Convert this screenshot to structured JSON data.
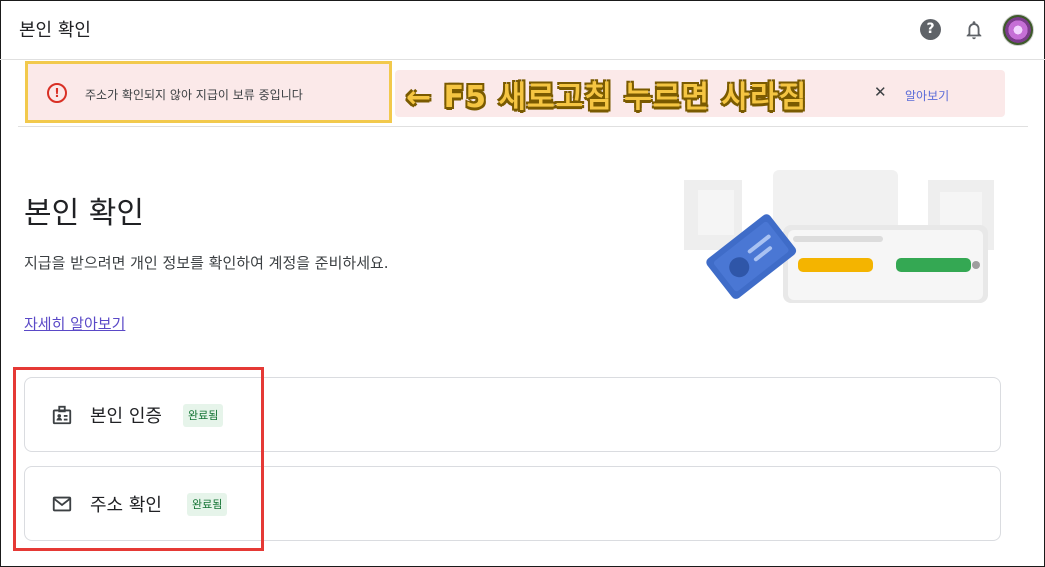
{
  "header": {
    "title": "본인 확인",
    "help_icon": "help-circle-icon",
    "notification_icon": "bell-icon",
    "avatar_icon": "user-avatar"
  },
  "alert": {
    "message": "주소가 확인되지 않아 지급이 보류 중입니다",
    "link_label": "알아보기",
    "icon": "error-circle-icon",
    "annotation": "← F5 새로고침 누르면 사라짐"
  },
  "main": {
    "title": "본인 확인",
    "description": "지급을 받으려면 개인 정보를 확인하여 계정을 준비하세요.",
    "learn_more": "자세히 알아보기"
  },
  "cards": [
    {
      "label": "본인 인증",
      "status": "완료됨",
      "icon": "id-badge-icon"
    },
    {
      "label": "주소 확인",
      "status": "완료됨",
      "icon": "mail-icon"
    }
  ],
  "colors": {
    "alert_background": "#fbe9e9",
    "alert_icon": "#d93025",
    "annotation_text": "#f5c542",
    "annotation_box": "#f2c94c",
    "highlight_box": "#e53935",
    "badge_background": "#e6f4ea",
    "badge_text": "#137333",
    "link": "#5a49c7"
  }
}
